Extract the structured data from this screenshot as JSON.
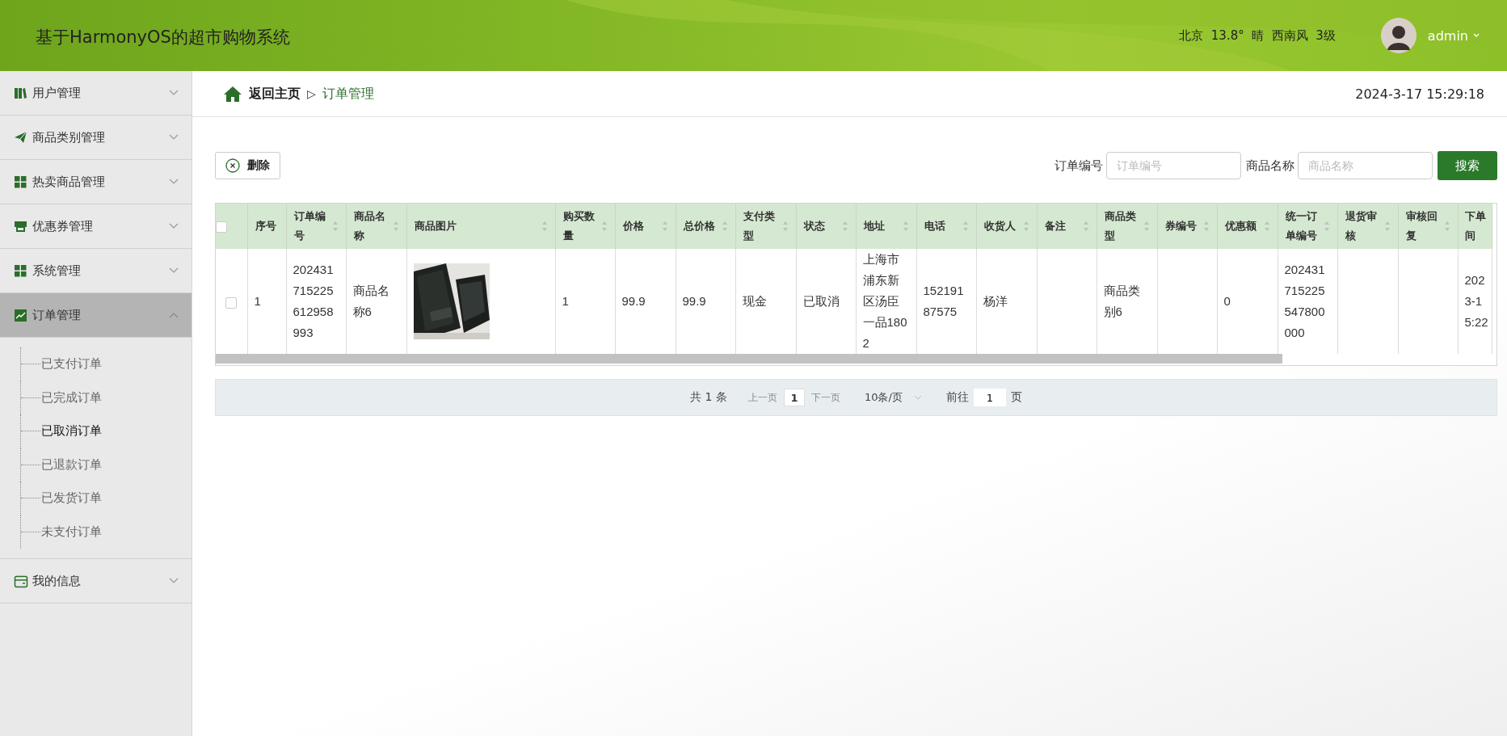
{
  "header": {
    "title": "基于HarmonyOS的超市购物系统",
    "weather": "北京  13.8°  晴  西南风  3级",
    "user": "admin"
  },
  "sidebar": {
    "items": [
      {
        "label": "用户管理",
        "expanded": false
      },
      {
        "label": "商品类别管理",
        "expanded": false
      },
      {
        "label": "热卖商品管理",
        "expanded": false
      },
      {
        "label": "优惠券管理",
        "expanded": false
      },
      {
        "label": "系统管理",
        "expanded": false
      },
      {
        "label": "订单管理",
        "expanded": true,
        "children": [
          {
            "label": "已支付订单",
            "selected": false
          },
          {
            "label": "已完成订单",
            "selected": false
          },
          {
            "label": "已取消订单",
            "selected": true
          },
          {
            "label": "已退款订单",
            "selected": false
          },
          {
            "label": "已发货订单",
            "selected": false
          },
          {
            "label": "未支付订单",
            "selected": false
          }
        ]
      },
      {
        "label": "我的信息",
        "expanded": false
      }
    ]
  },
  "breadcrumb": {
    "home": "返回主页",
    "separator": "▷",
    "current": "订单管理",
    "datetime": "2024-3-17 15:29:18"
  },
  "toolbar": {
    "delete_button": "删除",
    "filters": [
      {
        "label": "订单编号",
        "placeholder": "订单编号"
      },
      {
        "label": "商品名称",
        "placeholder": "商品名称"
      }
    ],
    "search_button": "搜索"
  },
  "table": {
    "header_checked": false,
    "columns": [
      {
        "label": "序号",
        "sortable": false
      },
      {
        "label": "订单编号",
        "sortable": true
      },
      {
        "label": "商品名称",
        "sortable": true
      },
      {
        "label": "商品图片",
        "sortable": true
      },
      {
        "label": "购买数量",
        "sortable": true
      },
      {
        "label": "价格",
        "sortable": true
      },
      {
        "label": "总价格",
        "sortable": true
      },
      {
        "label": "支付类型",
        "sortable": true
      },
      {
        "label": "状态",
        "sortable": true
      },
      {
        "label": "地址",
        "sortable": true
      },
      {
        "label": "电话",
        "sortable": true
      },
      {
        "label": "收货人",
        "sortable": true
      },
      {
        "label": "备注",
        "sortable": true
      },
      {
        "label": "商品类型",
        "sortable": true
      },
      {
        "label": "券编号",
        "sortable": true
      },
      {
        "label": "优惠额",
        "sortable": true
      },
      {
        "label": "统一订单编号",
        "sortable": true
      },
      {
        "label": "退货审核",
        "sortable": true
      },
      {
        "label": "审核回复",
        "sortable": true
      },
      {
        "label": "下单间",
        "sortable": false
      }
    ],
    "rows": [
      {
        "checked": false,
        "cells": [
          {
            "kind": "text",
            "text": "1"
          },
          {
            "kind": "text",
            "text": "202431715225612958993"
          },
          {
            "kind": "text",
            "text": "商品名称6"
          },
          {
            "kind": "picture"
          },
          {
            "kind": "text",
            "text": "1"
          },
          {
            "kind": "text",
            "text": "99.9"
          },
          {
            "kind": "text",
            "text": "99.9"
          },
          {
            "kind": "text",
            "text": "现金"
          },
          {
            "kind": "text",
            "text": "已取消"
          },
          {
            "kind": "text",
            "text": "上海市浦东新区汤臣一品1802"
          },
          {
            "kind": "text",
            "text": "15219187575"
          },
          {
            "kind": "text",
            "text": "杨洋"
          },
          {
            "kind": "empty"
          },
          {
            "kind": "text",
            "text": "商品类别6"
          },
          {
            "kind": "empty"
          },
          {
            "kind": "text",
            "text": "0"
          },
          {
            "kind": "text",
            "text": "202431715225547800000"
          },
          {
            "kind": "empty"
          },
          {
            "kind": "empty"
          },
          {
            "kind": "text",
            "text": "202\n3-1\n5:22"
          }
        ]
      }
    ]
  },
  "pagination": {
    "total": "共 1 条",
    "prev": "上一页",
    "pages": [
      {
        "label": "1",
        "selected": true
      }
    ],
    "next": "下一页",
    "page_size": "10条/页",
    "goto_label": "前往",
    "goto_value": "1",
    "page_suffix": "页"
  }
}
